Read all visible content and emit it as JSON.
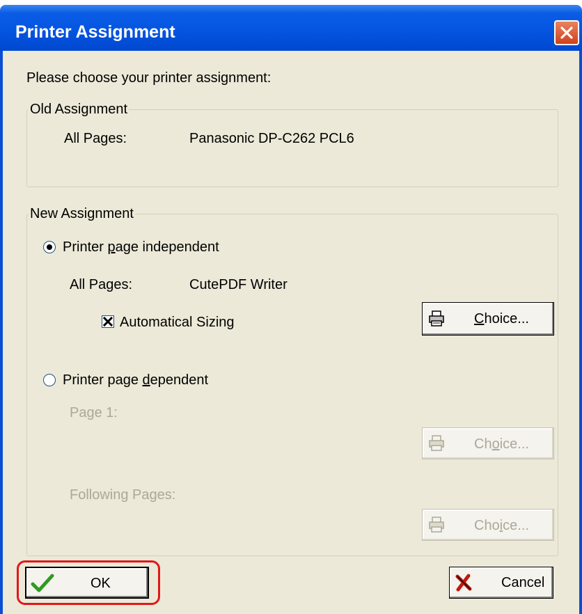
{
  "window": {
    "title": "Printer Assignment"
  },
  "prompt": "Please choose your printer assignment:",
  "old_assignment": {
    "legend": "Old Assignment",
    "label": "All Pages:",
    "value": "Panasonic DP-C262 PCL6"
  },
  "new_assignment": {
    "legend": "New Assignment",
    "independent": {
      "label_pre": "Printer ",
      "label_mnemonic": "p",
      "label_post": "age independent",
      "selected": true,
      "all_pages_label": "All Pages:",
      "all_pages_value": "CutePDF Writer",
      "auto_sizing_label": "Automatical Sizing",
      "auto_sizing_checked": true,
      "choice_mnemonic": "C",
      "choice_rest": "hoice..."
    },
    "dependent": {
      "label_pre": "Printer page ",
      "label_mnemonic": "d",
      "label_post": "ependent",
      "selected": false,
      "page1_label": "Page 1:",
      "page1_choice_pre": "Ch",
      "page1_choice_mnemonic": "o",
      "page1_choice_post": "ice...",
      "following_label": "Following Pages:",
      "following_choice_pre": "Cho",
      "following_choice_mnemonic": "i",
      "following_choice_post": "ce..."
    }
  },
  "buttons": {
    "ok_label": "OK",
    "cancel_label": "Cancel"
  },
  "colors": {
    "titlebar": "#0555e0",
    "dialog_face": "#ece9d8",
    "highlight": "#e01818"
  }
}
